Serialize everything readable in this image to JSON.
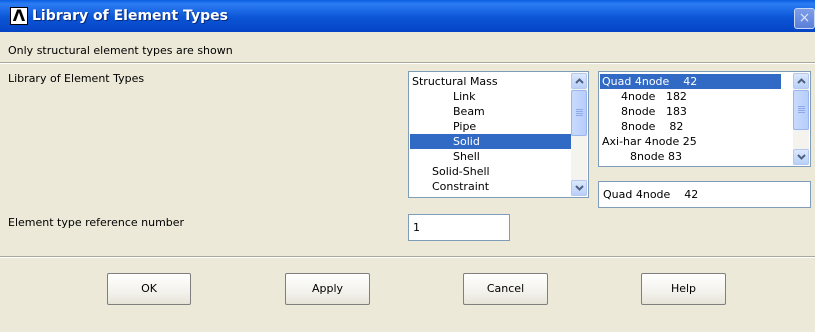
{
  "window": {
    "title": "Library of Element Types",
    "logo_glyph": "Λ",
    "close_glyph": "×"
  },
  "info_text": "Only structural element types are shown",
  "library_label": "Library of Element Types",
  "category_list": {
    "items": [
      "Structural Mass",
      "Link",
      "Beam",
      "Pipe",
      "Solid",
      "Shell",
      "Solid-Shell",
      "Constraint"
    ],
    "selected": "Solid"
  },
  "element_list": {
    "items": [
      "Quad 4node    42",
      "4node   182",
      "8node   183",
      "8node    82",
      "Axi-har 4node 25",
      "8node 83"
    ],
    "selected": "Quad 4node    42"
  },
  "selected_element_field": {
    "value": "Quad 4node    42"
  },
  "reference_number": {
    "label": "Element type reference number",
    "value": "1"
  },
  "buttons": {
    "ok": "OK",
    "apply": "Apply",
    "cancel": "Cancel",
    "help": "Help"
  },
  "colors": {
    "titlebar": "#0b55d6",
    "selection": "#316ac5",
    "dialog_bg": "#ece9d8"
  }
}
